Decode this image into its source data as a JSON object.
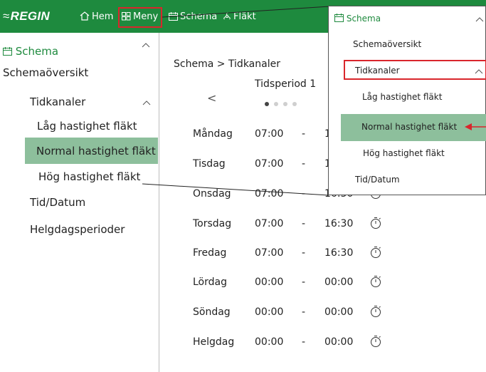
{
  "topbar": {
    "logo": "REGIN",
    "nav": [
      {
        "label": "Hem",
        "icon": "home-icon"
      },
      {
        "label": "Meny",
        "icon": "grid-icon"
      },
      {
        "label": "Schema",
        "icon": "calendar-icon"
      },
      {
        "label": "Fläkt",
        "icon": "fan-icon"
      }
    ]
  },
  "sidebar": {
    "section": "Schema",
    "items": [
      {
        "label": "Schemaöversikt"
      },
      {
        "label": "Tidkanaler"
      },
      {
        "label": "Låg hastighet fläkt"
      },
      {
        "label": "Normal hastighet fläkt"
      },
      {
        "label": "Hög hastighet fläkt"
      },
      {
        "label": "Tid/Datum"
      },
      {
        "label": "Helgdagsperioder"
      }
    ]
  },
  "content": {
    "breadcrumb": "Schema > Tidkanaler",
    "period_title": "Tidsperiod 1",
    "prev_label": "<",
    "rows": [
      {
        "day": "Måndag",
        "start": "07:00",
        "dash": "-",
        "end": "1"
      },
      {
        "day": "Tisdag",
        "start": "07:00",
        "dash": "-",
        "end": "1"
      },
      {
        "day": "Onsdag",
        "start": "07:00",
        "dash": "-",
        "end": "16:30"
      },
      {
        "day": "Torsdag",
        "start": "07:00",
        "dash": "-",
        "end": "16:30"
      },
      {
        "day": "Fredag",
        "start": "07:00",
        "dash": "-",
        "end": "16:30"
      },
      {
        "day": "Lördag",
        "start": "00:00",
        "dash": "-",
        "end": "00:00"
      },
      {
        "day": "Söndag",
        "start": "00:00",
        "dash": "-",
        "end": "00:00"
      },
      {
        "day": "Helgdag",
        "start": "00:00",
        "dash": "-",
        "end": "00:00"
      }
    ]
  },
  "popup": {
    "section": "Schema",
    "items": [
      {
        "label": "Schemaöversikt"
      },
      {
        "label": "Tidkanaler"
      },
      {
        "label": "Låg hastighet fläkt"
      },
      {
        "label": "Normal hastighet fläkt"
      },
      {
        "label": "Hög hastighet fläkt"
      },
      {
        "label": "Tid/Datum"
      }
    ]
  },
  "colors": {
    "brand_green": "#1e8a3e",
    "selected_bg": "#8dbf9c",
    "highlight_red": "#d9262c"
  }
}
